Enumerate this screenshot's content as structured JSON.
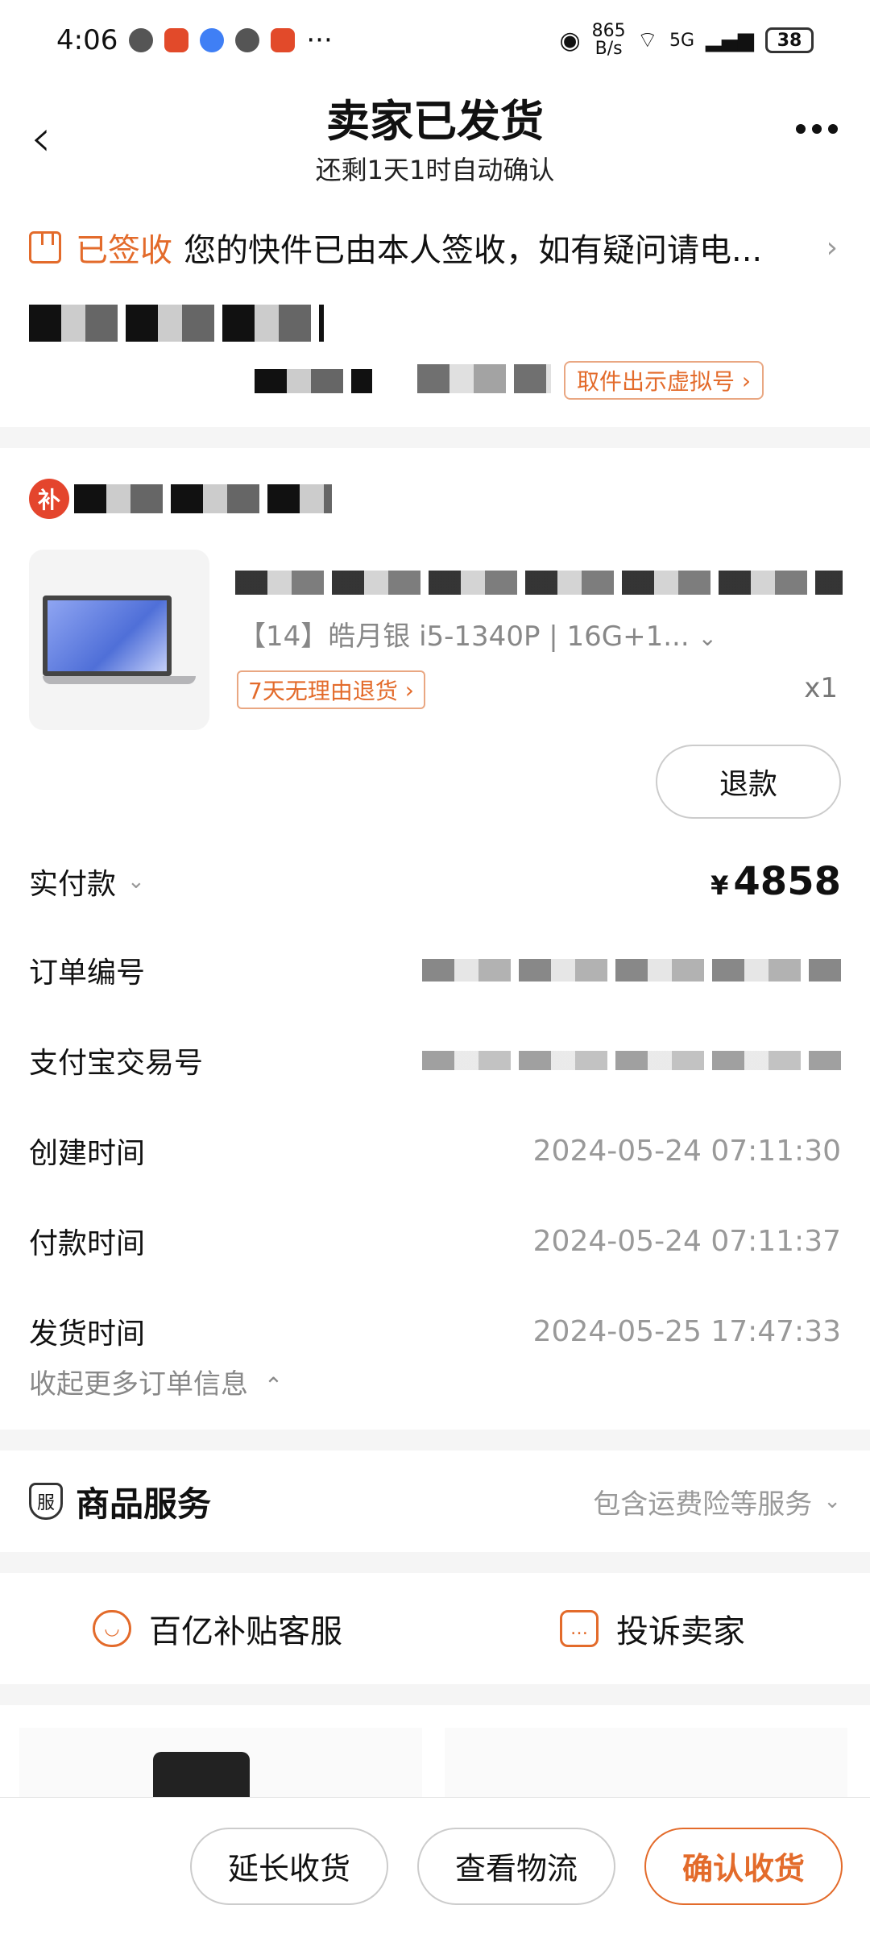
{
  "status_bar": {
    "time": "4:06",
    "net_speed": "865",
    "net_speed_unit": "B/s",
    "network": "5G",
    "battery": "38"
  },
  "header": {
    "title": "卖家已发货",
    "subtitle": "还剩1天1时自动确认"
  },
  "logistics": {
    "status": "已签收",
    "message": "您的快件已由本人签收，如有疑问请电...",
    "virtual_number_button": "取件出示虚拟号"
  },
  "product": {
    "shop_badge": "补",
    "spec": "【14】皓月银 i5-1340P | 16G+1...",
    "return_tag": "7天无理由退货",
    "quantity": "x1",
    "refund_button": "退款"
  },
  "order_info": {
    "paid_label": "实付款",
    "currency": "¥",
    "paid_amount": "4858",
    "order_number_label": "订单编号",
    "alipay_label": "支付宝交易号",
    "created_label": "创建时间",
    "created_value": "2024-05-24 07:11:30",
    "paid_time_label": "付款时间",
    "paid_time_value": "2024-05-24 07:11:37",
    "shipped_label": "发货时间",
    "shipped_value": "2024-05-25 17:47:33",
    "collapse_label": "收起更多订单信息"
  },
  "service": {
    "icon_text": "服",
    "title": "商品服务",
    "value": "包含运费险等服务"
  },
  "contact": {
    "support": "百亿补贴客服",
    "complain": "投诉卖家"
  },
  "bottom_bar": {
    "extend": "延长收货",
    "logistics": "查看物流",
    "confirm": "确认收货"
  },
  "colors": {
    "accent": "#e36b2b",
    "badge": "#e4452d"
  }
}
